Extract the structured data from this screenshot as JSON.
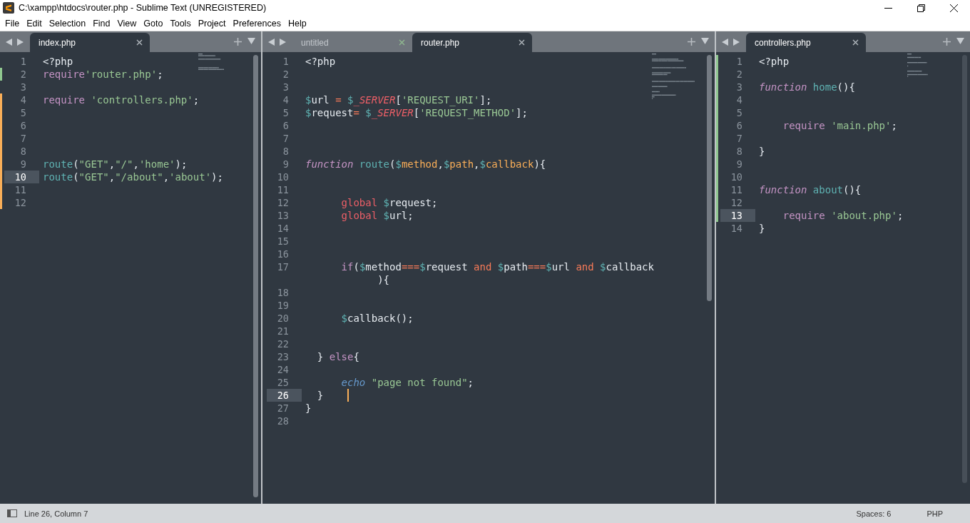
{
  "window": {
    "title": "C:\\xampp\\htdocs\\router.php - Sublime Text (UNREGISTERED)"
  },
  "menu": [
    "File",
    "Edit",
    "Selection",
    "Find",
    "View",
    "Goto",
    "Tools",
    "Project",
    "Preferences",
    "Help"
  ],
  "panes": [
    {
      "tabs": [
        {
          "label": "index.php",
          "selected": true
        }
      ],
      "scrollbar": true,
      "lines": [
        {
          "n": "1",
          "current": false,
          "kind": "unchanged",
          "tokens": [
            {
              "text": "<?php",
              "kind": "plain"
            }
          ]
        },
        {
          "n": "2",
          "current": false,
          "kind": "added",
          "tokens": [
            {
              "text": "require",
              "kind": "keyword"
            },
            {
              "text": "'router.php'",
              "kind": "string"
            },
            {
              "text": ";",
              "kind": "plain"
            }
          ]
        },
        {
          "n": "3",
          "current": false,
          "kind": "unchanged"
        },
        {
          "n": "4",
          "current": false,
          "kind": "modified",
          "tokens": [
            {
              "text": "require ",
              "kind": "keyword"
            },
            {
              "text": "'controllers.php'",
              "kind": "string"
            },
            {
              "text": ";",
              "kind": "plain"
            }
          ]
        },
        {
          "n": "5",
          "current": false,
          "kind": "modified"
        },
        {
          "n": "6",
          "current": false,
          "kind": "modified"
        },
        {
          "n": "7",
          "current": false,
          "kind": "modified"
        },
        {
          "n": "8",
          "current": false,
          "kind": "modified"
        },
        {
          "n": "9",
          "current": false,
          "kind": "modified",
          "tokens": [
            {
              "text": "route",
              "kind": "func"
            },
            {
              "text": "(",
              "kind": "plain"
            },
            {
              "text": "\"GET\"",
              "kind": "string"
            },
            {
              "text": ",",
              "kind": "plain"
            },
            {
              "text": "\"/\"",
              "kind": "string"
            },
            {
              "text": ",",
              "kind": "plain"
            },
            {
              "text": "'home'",
              "kind": "string"
            },
            {
              "text": ");",
              "kind": "plain"
            }
          ]
        },
        {
          "n": "10",
          "current": true,
          "kind": "modified",
          "tokens": [
            {
              "text": "route",
              "kind": "func"
            },
            {
              "text": "(",
              "kind": "plain"
            },
            {
              "text": "\"GET\"",
              "kind": "string"
            },
            {
              "text": ",",
              "kind": "plain"
            },
            {
              "text": "\"/about\"",
              "kind": "string"
            },
            {
              "text": ",",
              "kind": "plain"
            },
            {
              "text": "'about'",
              "kind": "string"
            },
            {
              "text": ");",
              "kind": "plain"
            }
          ]
        },
        {
          "n": "11",
          "current": false,
          "kind": "modified"
        },
        {
          "n": "12",
          "current": false,
          "kind": "modified"
        }
      ]
    },
    {
      "tabs": [
        {
          "label": "untitled",
          "selected": false
        },
        {
          "label": "router.php",
          "selected": true
        }
      ],
      "scrollbar": true,
      "lines": [
        {
          "n": "1",
          "current": false,
          "kind": "unchanged",
          "tokens": [
            {
              "text": "<?php",
              "kind": "plain"
            }
          ]
        },
        {
          "n": "2",
          "current": false,
          "kind": "unchanged"
        },
        {
          "n": "3",
          "current": false,
          "kind": "unchanged"
        },
        {
          "n": "4",
          "current": false,
          "kind": "unchanged",
          "tokens": [
            {
              "text": "$",
              "kind": "sign"
            },
            {
              "text": "url ",
              "kind": "plain"
            },
            {
              "text": "= ",
              "kind": "op"
            },
            {
              "text": "$",
              "kind": "sign"
            },
            {
              "text": "_SERVER",
              "kind": "support"
            },
            {
              "text": "[",
              "kind": "plain"
            },
            {
              "text": "'REQUEST_URI'",
              "kind": "string"
            },
            {
              "text": "];",
              "kind": "plain"
            }
          ]
        },
        {
          "n": "5",
          "current": false,
          "kind": "unchanged",
          "tokens": [
            {
              "text": "$",
              "kind": "sign"
            },
            {
              "text": "request",
              "kind": "plain"
            },
            {
              "text": "= ",
              "kind": "op"
            },
            {
              "text": "$",
              "kind": "sign"
            },
            {
              "text": "_SERVER",
              "kind": "support"
            },
            {
              "text": "[",
              "kind": "plain"
            },
            {
              "text": "'REQUEST_METHOD'",
              "kind": "string"
            },
            {
              "text": "];",
              "kind": "plain"
            }
          ]
        },
        {
          "n": "6",
          "current": false,
          "kind": "unchanged"
        },
        {
          "n": "7",
          "current": false,
          "kind": "unchanged"
        },
        {
          "n": "8",
          "current": false,
          "kind": "unchanged"
        },
        {
          "n": "9",
          "current": false,
          "kind": "unchanged",
          "tokens": [
            {
              "text": "function ",
              "kind": "storage"
            },
            {
              "text": "route",
              "kind": "func"
            },
            {
              "text": "(",
              "kind": "plain"
            },
            {
              "text": "$",
              "kind": "sign"
            },
            {
              "text": "method",
              "kind": "param"
            },
            {
              "text": ",",
              "kind": "plain"
            },
            {
              "text": "$",
              "kind": "sign"
            },
            {
              "text": "path",
              "kind": "param"
            },
            {
              "text": ",",
              "kind": "plain"
            },
            {
              "text": "$",
              "kind": "sign"
            },
            {
              "text": "callback",
              "kind": "param"
            },
            {
              "text": "){",
              "kind": "plain"
            }
          ]
        },
        {
          "n": "10",
          "current": false,
          "kind": "unchanged"
        },
        {
          "n": "11",
          "current": false,
          "kind": "unchanged"
        },
        {
          "n": "12",
          "current": false,
          "kind": "unchanged",
          "tokens": [
            {
              "text": "      global ",
              "kind": "global"
            },
            {
              "text": "$",
              "kind": "sign"
            },
            {
              "text": "request;",
              "kind": "plain"
            }
          ]
        },
        {
          "n": "13",
          "current": false,
          "kind": "unchanged",
          "tokens": [
            {
              "text": "      global ",
              "kind": "global"
            },
            {
              "text": "$",
              "kind": "sign"
            },
            {
              "text": "url;",
              "kind": "plain"
            }
          ]
        },
        {
          "n": "14",
          "current": false,
          "kind": "unchanged"
        },
        {
          "n": "15",
          "current": false,
          "kind": "unchanged"
        },
        {
          "n": "16",
          "current": false,
          "kind": "unchanged"
        },
        {
          "n": "17",
          "current": false,
          "kind": "unchanged",
          "tokens": [
            {
              "text": "      if",
              "kind": "keyword"
            },
            {
              "text": "(",
              "kind": "plain"
            },
            {
              "text": "$",
              "kind": "sign"
            },
            {
              "text": "method",
              "kind": "plain"
            },
            {
              "text": "===",
              "kind": "op"
            },
            {
              "text": "$",
              "kind": "sign"
            },
            {
              "text": "request ",
              "kind": "plain"
            },
            {
              "text": "and ",
              "kind": "op"
            },
            {
              "text": "$",
              "kind": "sign"
            },
            {
              "text": "path",
              "kind": "plain"
            },
            {
              "text": "===",
              "kind": "op"
            },
            {
              "text": "$",
              "kind": "sign"
            },
            {
              "text": "url ",
              "kind": "plain"
            },
            {
              "text": "and ",
              "kind": "op"
            },
            {
              "text": "$",
              "kind": "sign"
            },
            {
              "text": "callback",
              "kind": "plain"
            }
          ],
          "wrap": [
            {
              "text": "){",
              "kind": "plain"
            }
          ]
        },
        {
          "n": "18",
          "current": false,
          "kind": "unchanged"
        },
        {
          "n": "19",
          "current": false,
          "kind": "unchanged"
        },
        {
          "n": "20",
          "current": false,
          "kind": "unchanged",
          "tokens": [
            {
              "text": "      $",
              "kind": "sign"
            },
            {
              "text": "callback();",
              "kind": "plain"
            }
          ]
        },
        {
          "n": "21",
          "current": false,
          "kind": "unchanged"
        },
        {
          "n": "22",
          "current": false,
          "kind": "unchanged"
        },
        {
          "n": "23",
          "current": false,
          "kind": "unchanged",
          "tokens": [
            {
              "text": "  } ",
              "kind": "plain"
            },
            {
              "text": "else",
              "kind": "keyword"
            },
            {
              "text": "{",
              "kind": "plain"
            }
          ]
        },
        {
          "n": "24",
          "current": false,
          "kind": "unchanged"
        },
        {
          "n": "25",
          "current": false,
          "kind": "unchanged",
          "tokens": [
            {
              "text": "      echo ",
              "kind": "echo"
            },
            {
              "text": "\"page not found\"",
              "kind": "string"
            },
            {
              "text": ";",
              "kind": "plain"
            }
          ]
        },
        {
          "n": "26",
          "current": true,
          "kind": "unchanged",
          "caret": true,
          "tokens": [
            {
              "text": "  }",
              "kind": "plain"
            }
          ]
        },
        {
          "n": "27",
          "current": false,
          "kind": "unchanged",
          "tokens": [
            {
              "text": "}",
              "kind": "plain"
            }
          ]
        },
        {
          "n": "28",
          "current": false,
          "kind": "unchanged"
        }
      ]
    },
    {
      "tabs": [
        {
          "label": "controllers.php",
          "selected": true
        }
      ],
      "scrollbar": true,
      "lines": [
        {
          "n": "1",
          "current": false,
          "kind": "added",
          "tokens": [
            {
              "text": "<?php",
              "kind": "plain"
            }
          ]
        },
        {
          "n": "2",
          "current": false,
          "kind": "added"
        },
        {
          "n": "3",
          "current": false,
          "kind": "added",
          "tokens": [
            {
              "text": "function ",
              "kind": "storage"
            },
            {
              "text": "home",
              "kind": "func"
            },
            {
              "text": "(){",
              "kind": "plain"
            }
          ]
        },
        {
          "n": "4",
          "current": false,
          "kind": "added"
        },
        {
          "n": "5",
          "current": false,
          "kind": "added"
        },
        {
          "n": "6",
          "current": false,
          "kind": "added",
          "tokens": [
            {
              "text": "    require ",
              "kind": "keyword"
            },
            {
              "text": "'main.php'",
              "kind": "string"
            },
            {
              "text": ";",
              "kind": "plain"
            }
          ]
        },
        {
          "n": "7",
          "current": false,
          "kind": "added"
        },
        {
          "n": "8",
          "current": false,
          "kind": "added",
          "tokens": [
            {
              "text": "}",
              "kind": "plain"
            }
          ]
        },
        {
          "n": "9",
          "current": false,
          "kind": "added"
        },
        {
          "n": "10",
          "current": false,
          "kind": "added"
        },
        {
          "n": "11",
          "current": false,
          "kind": "added",
          "tokens": [
            {
              "text": "function ",
              "kind": "storage"
            },
            {
              "text": "about",
              "kind": "func"
            },
            {
              "text": "(){",
              "kind": "plain"
            }
          ]
        },
        {
          "n": "12",
          "current": false,
          "kind": "added"
        },
        {
          "n": "13",
          "current": true,
          "kind": "added",
          "tokens": [
            {
              "text": "    require ",
              "kind": "keyword"
            },
            {
              "text": "'about.php'",
              "kind": "string"
            },
            {
              "text": ";",
              "kind": "plain"
            }
          ]
        },
        {
          "n": "14",
          "current": false,
          "kind": "unchanged",
          "tokens": [
            {
              "text": "}",
              "kind": "plain"
            }
          ]
        }
      ]
    }
  ],
  "status_bar": {
    "position": "Line 26, Column 7",
    "indentation": "Spaces: 6",
    "syntax": "PHP"
  }
}
